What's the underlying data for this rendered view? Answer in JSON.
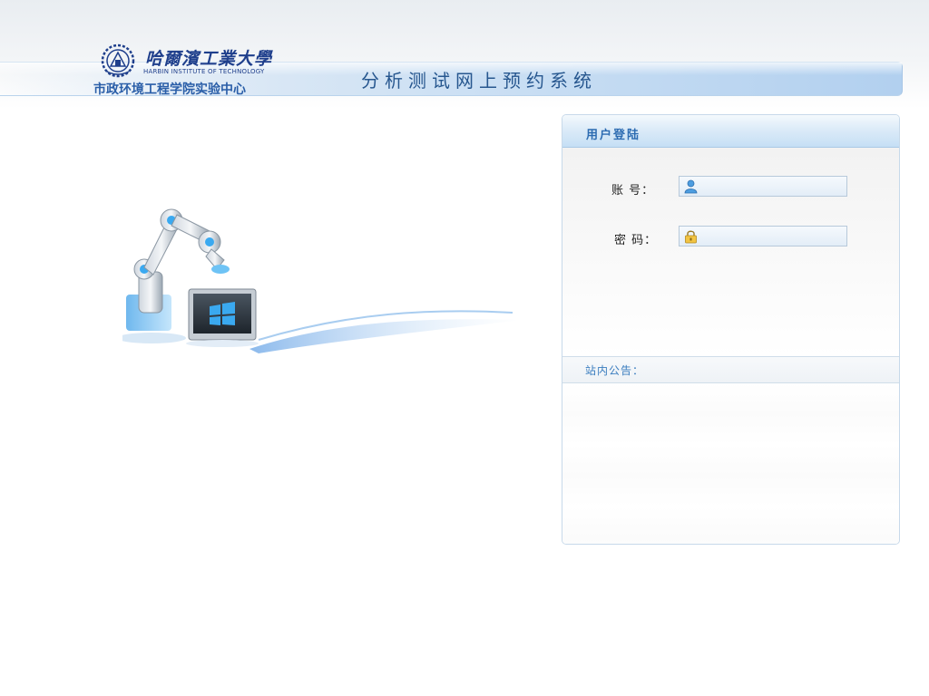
{
  "header": {
    "university_name": "哈爾濱工業大學",
    "university_name_en": "HARBIN INSTITUTE OF TECHNOLOGY",
    "department": "市政环境工程学院实验中心",
    "system_title": "分析测试网上预约系统"
  },
  "login": {
    "title": "用户登陆",
    "account_label": "账  号：",
    "account_value": "",
    "password_label": "密  码：",
    "password_value": "",
    "account_icon": "user-icon",
    "password_icon": "lock-icon"
  },
  "notice": {
    "title": "站内公告："
  },
  "colors": {
    "accent": "#2c6bb1",
    "title_text": "#27578f",
    "header_band": "#c7ddf3",
    "panel_border": "#c7d9ea"
  }
}
